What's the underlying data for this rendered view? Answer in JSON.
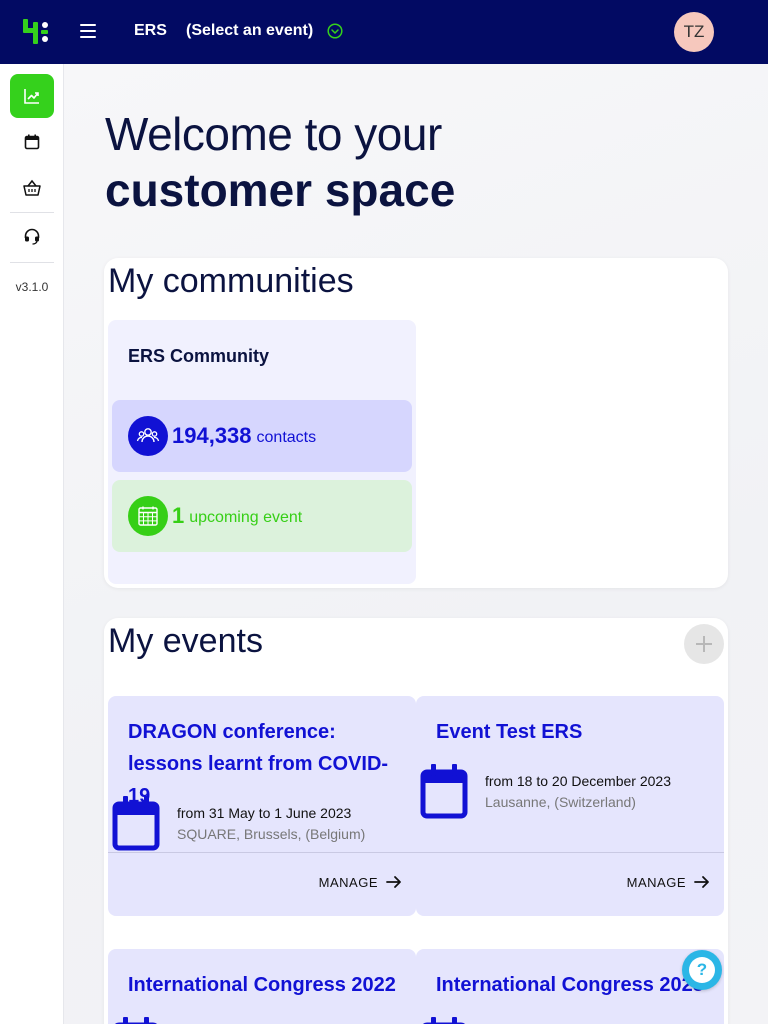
{
  "header": {
    "brand": "ERS",
    "event_select_label": "(Select an event)",
    "user_initials": "TZ",
    "accent_color": "#35d11c",
    "bg_color": "#020a63"
  },
  "sidebar": {
    "items": [
      {
        "name": "dashboard",
        "icon": "trending-up-icon",
        "active": true
      },
      {
        "name": "events",
        "icon": "calendar-icon",
        "active": false
      },
      {
        "name": "shop",
        "icon": "basket-icon",
        "active": false
      },
      {
        "name": "support",
        "icon": "headset-icon",
        "active": false
      }
    ],
    "version": "v3.1.0"
  },
  "welcome": {
    "line1": "Welcome to your",
    "line2": "customer space"
  },
  "communities": {
    "title": "My communities",
    "items": [
      {
        "name": "ERS Community",
        "contacts_count": "194,338",
        "contacts_label": "contacts",
        "events_count": "1",
        "events_label": "upcoming event"
      }
    ]
  },
  "events": {
    "title": "My events",
    "items": [
      {
        "title": "DRAGON conference: lessons learnt from COVID-19",
        "dates": "from 31 May to 1 June 2023",
        "place": "SQUARE, Brussels, (Belgium)",
        "action": "MANAGE"
      },
      {
        "title": "Event Test ERS",
        "dates": "from 18 to 20 December 2023",
        "place": "Lausanne, (Switzerland)",
        "action": "MANAGE"
      },
      {
        "title": "International Congress 2022"
      },
      {
        "title": "International Congress 2023"
      }
    ]
  },
  "help": {
    "label": "?"
  }
}
